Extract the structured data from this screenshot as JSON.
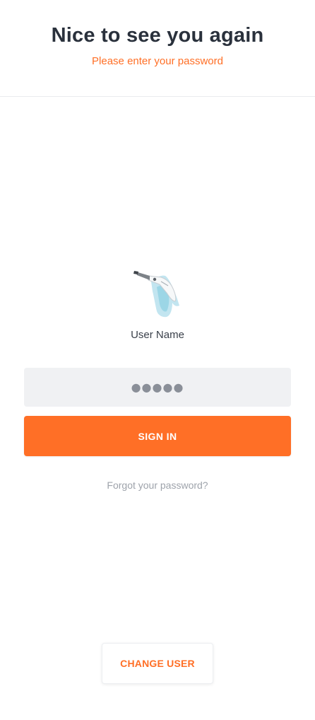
{
  "header": {
    "title": "Nice to see you again",
    "subtitle": "Please enter your password"
  },
  "user": {
    "avatar_icon": "dental-scanner-image",
    "name": "User Name"
  },
  "form": {
    "password_value": "●●●●●",
    "signin_label": "SIGN IN",
    "forgot_label": "Forgot your password?"
  },
  "footer": {
    "change_user_label": "CHANGE USER"
  },
  "colors": {
    "accent": "#ff6f26",
    "title": "#2a313c",
    "field_bg": "#f0f1f3",
    "muted_text": "#9ea3ab"
  }
}
